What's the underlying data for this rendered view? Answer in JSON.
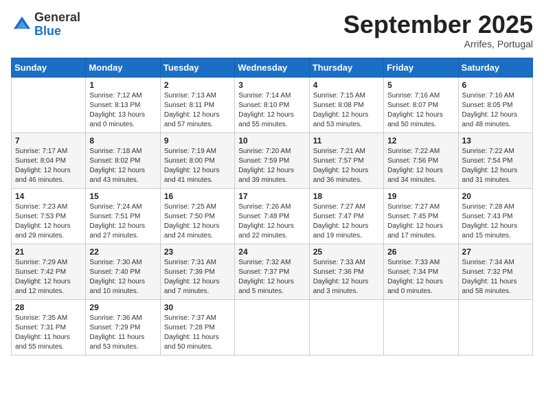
{
  "logo": {
    "general": "General",
    "blue": "Blue"
  },
  "title": "September 2025",
  "subtitle": "Arrifes, Portugal",
  "weekdays": [
    "Sunday",
    "Monday",
    "Tuesday",
    "Wednesday",
    "Thursday",
    "Friday",
    "Saturday"
  ],
  "weeks": [
    [
      {
        "day": "",
        "info": ""
      },
      {
        "day": "1",
        "info": "Sunrise: 7:12 AM\nSunset: 8:13 PM\nDaylight: 13 hours\nand 0 minutes."
      },
      {
        "day": "2",
        "info": "Sunrise: 7:13 AM\nSunset: 8:11 PM\nDaylight: 12 hours\nand 57 minutes."
      },
      {
        "day": "3",
        "info": "Sunrise: 7:14 AM\nSunset: 8:10 PM\nDaylight: 12 hours\nand 55 minutes."
      },
      {
        "day": "4",
        "info": "Sunrise: 7:15 AM\nSunset: 8:08 PM\nDaylight: 12 hours\nand 53 minutes."
      },
      {
        "day": "5",
        "info": "Sunrise: 7:16 AM\nSunset: 8:07 PM\nDaylight: 12 hours\nand 50 minutes."
      },
      {
        "day": "6",
        "info": "Sunrise: 7:16 AM\nSunset: 8:05 PM\nDaylight: 12 hours\nand 48 minutes."
      }
    ],
    [
      {
        "day": "7",
        "info": "Sunrise: 7:17 AM\nSunset: 8:04 PM\nDaylight: 12 hours\nand 46 minutes."
      },
      {
        "day": "8",
        "info": "Sunrise: 7:18 AM\nSunset: 8:02 PM\nDaylight: 12 hours\nand 43 minutes."
      },
      {
        "day": "9",
        "info": "Sunrise: 7:19 AM\nSunset: 8:00 PM\nDaylight: 12 hours\nand 41 minutes."
      },
      {
        "day": "10",
        "info": "Sunrise: 7:20 AM\nSunset: 7:59 PM\nDaylight: 12 hours\nand 39 minutes."
      },
      {
        "day": "11",
        "info": "Sunrise: 7:21 AM\nSunset: 7:57 PM\nDaylight: 12 hours\nand 36 minutes."
      },
      {
        "day": "12",
        "info": "Sunrise: 7:22 AM\nSunset: 7:56 PM\nDaylight: 12 hours\nand 34 minutes."
      },
      {
        "day": "13",
        "info": "Sunrise: 7:22 AM\nSunset: 7:54 PM\nDaylight: 12 hours\nand 31 minutes."
      }
    ],
    [
      {
        "day": "14",
        "info": "Sunrise: 7:23 AM\nSunset: 7:53 PM\nDaylight: 12 hours\nand 29 minutes."
      },
      {
        "day": "15",
        "info": "Sunrise: 7:24 AM\nSunset: 7:51 PM\nDaylight: 12 hours\nand 27 minutes."
      },
      {
        "day": "16",
        "info": "Sunrise: 7:25 AM\nSunset: 7:50 PM\nDaylight: 12 hours\nand 24 minutes."
      },
      {
        "day": "17",
        "info": "Sunrise: 7:26 AM\nSunset: 7:48 PM\nDaylight: 12 hours\nand 22 minutes."
      },
      {
        "day": "18",
        "info": "Sunrise: 7:27 AM\nSunset: 7:47 PM\nDaylight: 12 hours\nand 19 minutes."
      },
      {
        "day": "19",
        "info": "Sunrise: 7:27 AM\nSunset: 7:45 PM\nDaylight: 12 hours\nand 17 minutes."
      },
      {
        "day": "20",
        "info": "Sunrise: 7:28 AM\nSunset: 7:43 PM\nDaylight: 12 hours\nand 15 minutes."
      }
    ],
    [
      {
        "day": "21",
        "info": "Sunrise: 7:29 AM\nSunset: 7:42 PM\nDaylight: 12 hours\nand 12 minutes."
      },
      {
        "day": "22",
        "info": "Sunrise: 7:30 AM\nSunset: 7:40 PM\nDaylight: 12 hours\nand 10 minutes."
      },
      {
        "day": "23",
        "info": "Sunrise: 7:31 AM\nSunset: 7:39 PM\nDaylight: 12 hours\nand 7 minutes."
      },
      {
        "day": "24",
        "info": "Sunrise: 7:32 AM\nSunset: 7:37 PM\nDaylight: 12 hours\nand 5 minutes."
      },
      {
        "day": "25",
        "info": "Sunrise: 7:33 AM\nSunset: 7:36 PM\nDaylight: 12 hours\nand 3 minutes."
      },
      {
        "day": "26",
        "info": "Sunrise: 7:33 AM\nSunset: 7:34 PM\nDaylight: 12 hours\nand 0 minutes."
      },
      {
        "day": "27",
        "info": "Sunrise: 7:34 AM\nSunset: 7:32 PM\nDaylight: 11 hours\nand 58 minutes."
      }
    ],
    [
      {
        "day": "28",
        "info": "Sunrise: 7:35 AM\nSunset: 7:31 PM\nDaylight: 11 hours\nand 55 minutes."
      },
      {
        "day": "29",
        "info": "Sunrise: 7:36 AM\nSunset: 7:29 PM\nDaylight: 11 hours\nand 53 minutes."
      },
      {
        "day": "30",
        "info": "Sunrise: 7:37 AM\nSunset: 7:28 PM\nDaylight: 11 hours\nand 50 minutes."
      },
      {
        "day": "",
        "info": ""
      },
      {
        "day": "",
        "info": ""
      },
      {
        "day": "",
        "info": ""
      },
      {
        "day": "",
        "info": ""
      }
    ]
  ]
}
